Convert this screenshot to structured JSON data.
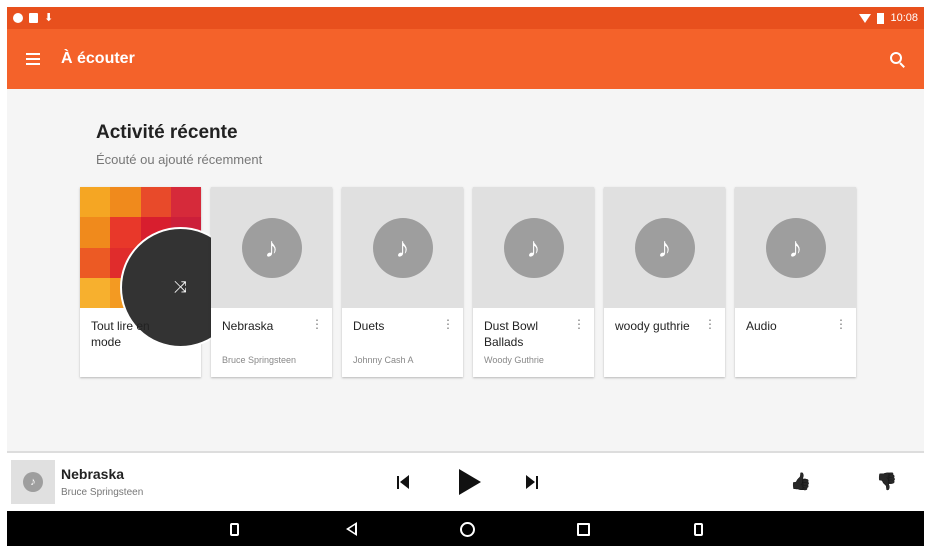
{
  "status_bar": {
    "time": "10:08",
    "icons_left": [
      "notification-icon",
      "android-icon",
      "download-icon"
    ],
    "icons_right": [
      "wifi-icon",
      "battery-icon"
    ]
  },
  "app_bar": {
    "title": "À écouter",
    "color": "#f4622a",
    "status_color": "#e8501d"
  },
  "recent": {
    "title": "Activité récente",
    "subtitle": "Écouté ou ajouté récemment",
    "cards": [
      {
        "title": "Tout lire en mode",
        "subtitle": "",
        "art": "shuffle-mosaic"
      },
      {
        "title": "Nebraska",
        "subtitle": "Bruce Springsteen",
        "art": "music-note-icon"
      },
      {
        "title": "Duets",
        "subtitle": "Johnny Cash A",
        "art": "music-note-icon"
      },
      {
        "title": "Dust Bowl Ballads",
        "subtitle": "Woody Guthrie",
        "art": "music-note-icon"
      },
      {
        "title": "woody guthrie",
        "subtitle": "",
        "art": "music-note-icon"
      },
      {
        "title": "Audio",
        "subtitle": "",
        "art": "music-note-icon"
      }
    ],
    "more_symbol": "⋮",
    "note_symbol": "♪",
    "shuffle_symbol": "⤨"
  },
  "player": {
    "title": "Nebraska",
    "artist": "Bruce Springsteen",
    "thumb_up_symbol": "👍",
    "thumb_down_symbol": "👎"
  },
  "mosaic_colors": [
    "#f5a623",
    "#f08a1c",
    "#e84a2a",
    "#d62a3a",
    "#f08a1c",
    "#e8382a",
    "#d81e2e",
    "#cc1f3a",
    "#ec5a24",
    "#e02c2c",
    "#d41f2a",
    "#c91d33",
    "#f7b02e",
    "#f39a22",
    "#ee6a26",
    "#de3a30"
  ]
}
